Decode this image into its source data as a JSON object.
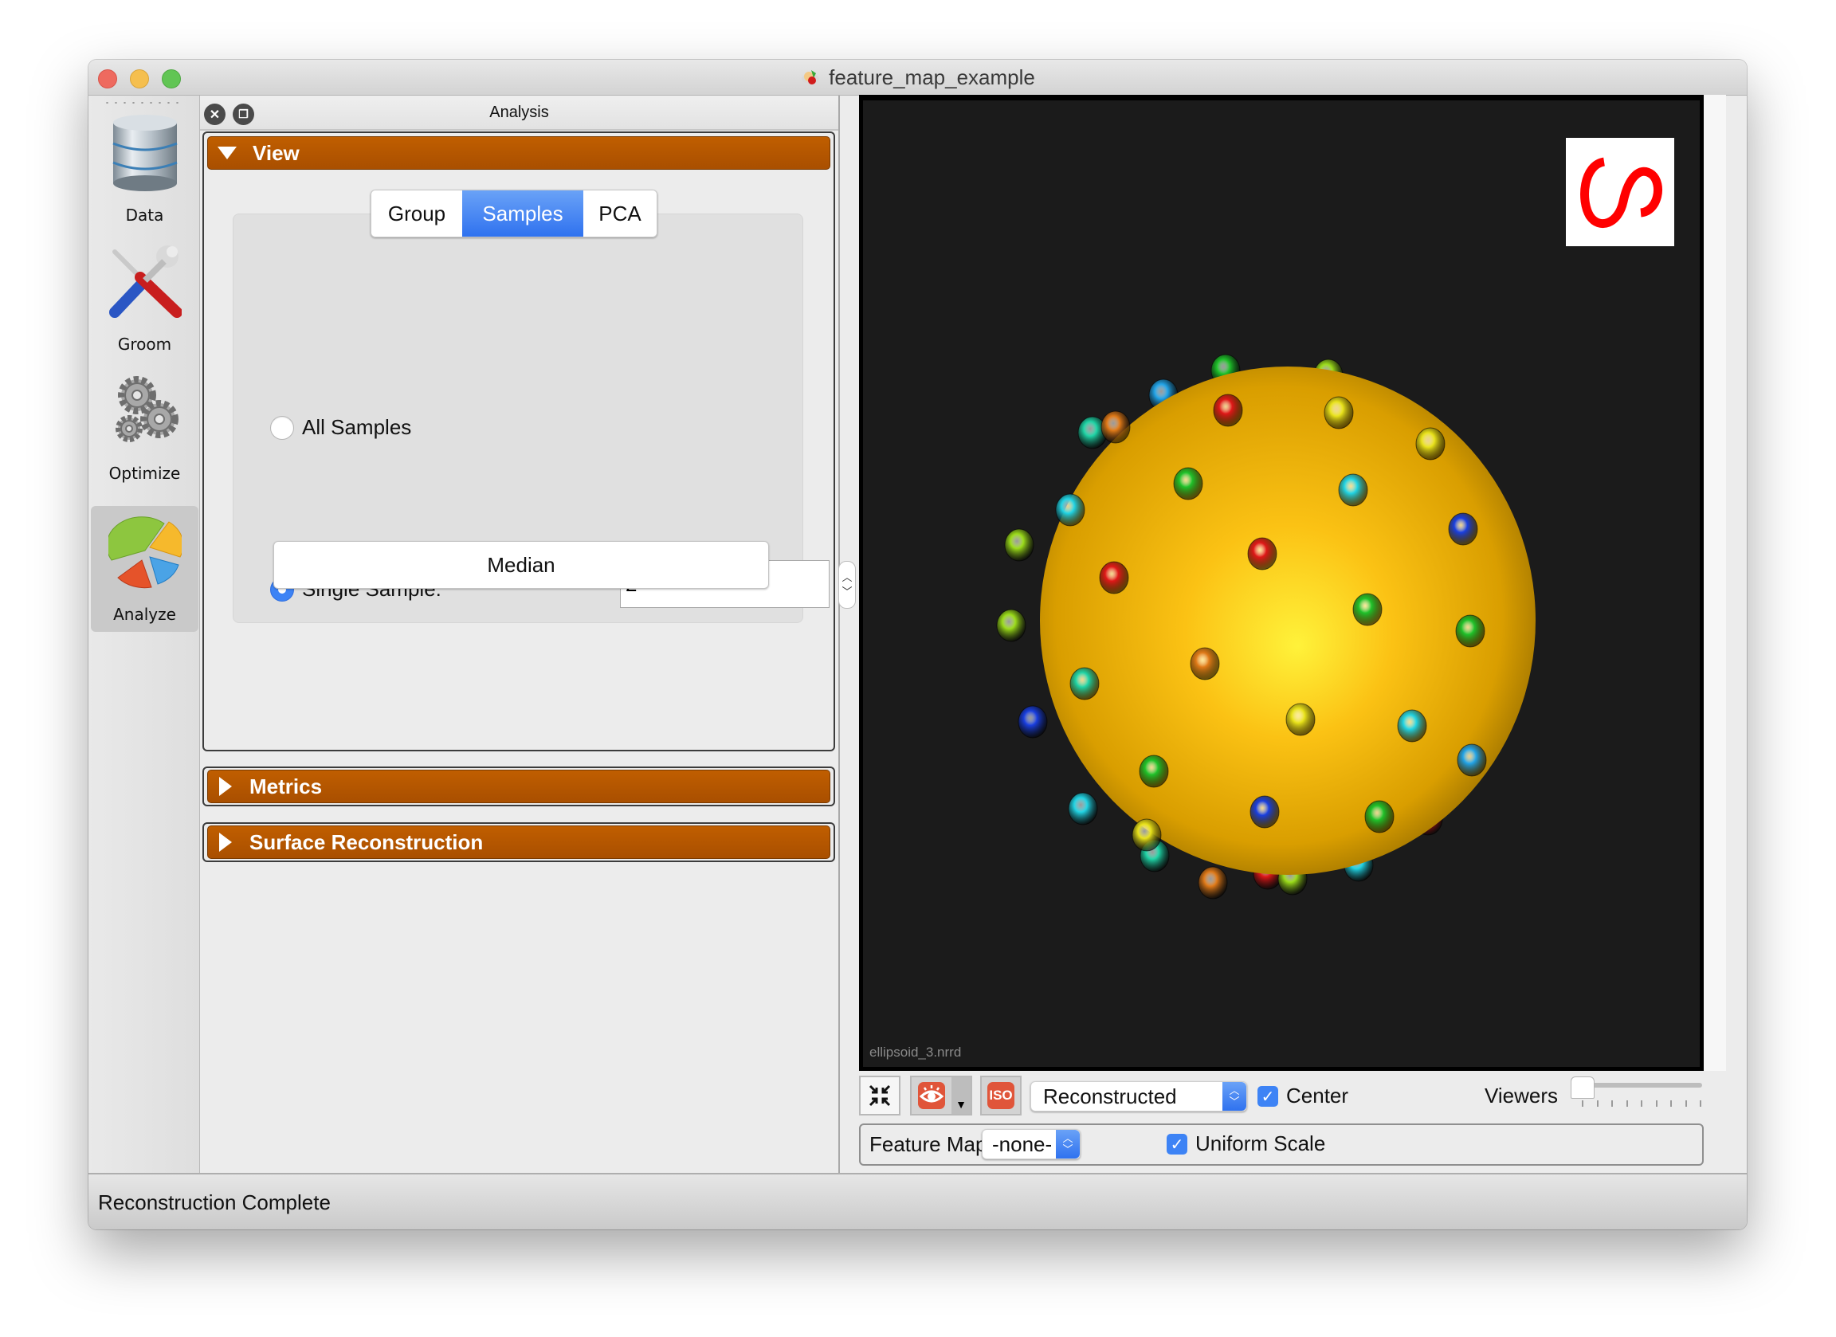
{
  "window": {
    "title": "feature_map_example",
    "app_icon": "shapeworks-app-icon",
    "traffic_lights": {
      "close": "#ee6a5f",
      "minimize": "#f5bf4f",
      "maximize": "#61c554"
    }
  },
  "sidebar": {
    "items": [
      {
        "label": "Data",
        "icon": "database-icon",
        "active": false
      },
      {
        "label": "Groom",
        "icon": "tools-icon",
        "active": false
      },
      {
        "label": "Optimize",
        "icon": "gears-icon",
        "active": false
      },
      {
        "label": "Analyze",
        "icon": "pie-chart-icon",
        "active": true
      }
    ]
  },
  "dock": {
    "title": "Analysis",
    "close_icon": "close-icon",
    "float_icon": "float-icon",
    "sections": {
      "view": {
        "label": "View",
        "expanded": true
      },
      "metrics": {
        "label": "Metrics",
        "expanded": false
      },
      "surface": {
        "label": "Surface Reconstruction",
        "expanded": false
      }
    },
    "tabs": [
      {
        "label": "Group",
        "selected": false
      },
      {
        "label": "Samples",
        "selected": true
      },
      {
        "label": "PCA",
        "selected": false
      }
    ],
    "samples": {
      "all_samples_label": "All Samples",
      "all_samples_checked": false,
      "single_sample_label": "Single Sample:",
      "single_sample_checked": true,
      "single_sample_value": "2",
      "median_label": "Median"
    }
  },
  "viewer": {
    "file_label": "ellipsoid_3.nrrd",
    "logo": "shapeworks-logo",
    "accent": "#ff0000",
    "shape_color": "#f5b800",
    "background": "#1b1b1b"
  },
  "toolbar": {
    "autoview_icon": "compress-arrows-icon",
    "visibility_icon": "eye-icon",
    "iso_label": "ISO",
    "display_mode": "Reconstructed",
    "center_label": "Center",
    "center_checked": true,
    "viewers_label": "Viewers",
    "viewers_value": 1,
    "viewers_max": 9,
    "feature_map_label": "Feature Map",
    "feature_map_value": "-none-",
    "uniform_scale_label": "Uniform Scale",
    "uniform_scale_checked": true
  },
  "status": {
    "text": "Reconstruction Complete"
  },
  "colors": {
    "section_header": "#b05300",
    "selected_tab": "#3d83f5",
    "checkbox": "#3d83f5"
  }
}
